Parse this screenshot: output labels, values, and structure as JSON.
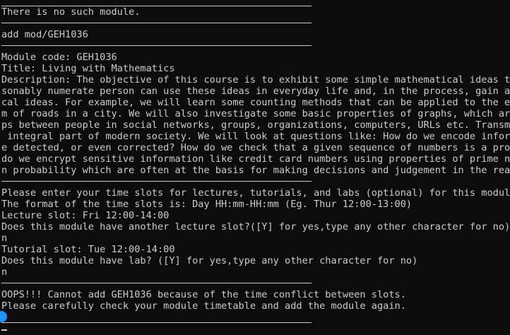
{
  "terminal": {
    "lines": [
      "There is no such module.",
      "add mod/GEH1036",
      "Module code: GEH1036",
      "Title: Living with Mathematics",
      "Description: The objective of this course is to exhibit some simple mathematical ideas tha",
      "sonably numerate person can use these ideas in everyday life and, in the process, gain an",
      "cal ideas. For example, we will learn some counting methods that can be applied to the enu",
      "m of roads in a city. We will also investigate some basic properties of graphs, which are",
      "ps between people in social networks, groups, organizations, computers, URLs etc. Transmis",
      " integral part of modern society. We will look at questions like: How do we encode informa",
      "e detected, or even corrected? How do we check that a given sequence of numbers is a prope",
      "do we encrypt sensitive information like credit card numbers using properties of prime num",
      "n probability which are often at the basis for making decisions and judgement in the real",
      "Please enter your time slots for lectures, tutorials, and labs (optional) for this module.",
      "The format of the time slots is: Day HH:mm-HH:mm (Eg. Thur 12:00-13:00)",
      "Lecture slot: Fri 12:00-14:00",
      "Does this module have another lecture slot?([Y] for yes,type any other character for no)",
      "n",
      "Tutorial slot: Tue 12:00-14:00",
      "Does this module have lab? ([Y] for yes,type any other character for no)",
      "n",
      "OOPS!!! Cannot add GEH1036 because of the time conflict between slots.",
      "Please carefully check your module timetable and add the module again."
    ]
  }
}
